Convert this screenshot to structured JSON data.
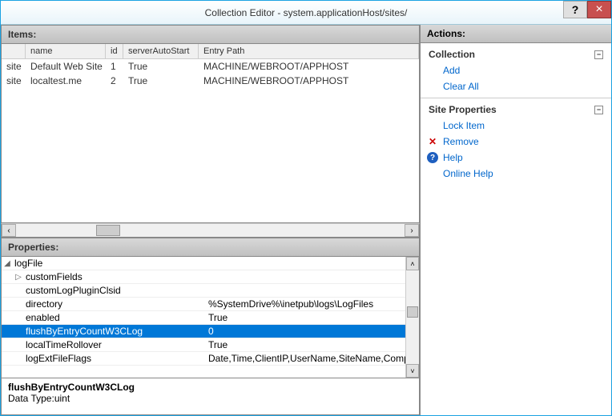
{
  "title": "Collection Editor - system.applicationHost/sites/",
  "itemsHeader": "Items:",
  "propsHeader": "Properties:",
  "actionsHeader": "Actions:",
  "columns": {
    "type": "",
    "name": "name",
    "id": "id",
    "serverAutoStart": "serverAutoStart",
    "entryPath": "Entry Path"
  },
  "items": [
    {
      "type": "site",
      "name": "Default Web Site",
      "id": "1",
      "serverAutoStart": "True",
      "entryPath": "MACHINE/WEBROOT/APPHOST"
    },
    {
      "type": "site",
      "name": "localtest.me",
      "id": "2",
      "serverAutoStart": "True",
      "entryPath": "MACHINE/WEBROOT/APPHOST"
    }
  ],
  "properties": {
    "root": "logFile",
    "rows": [
      {
        "indent": 1,
        "expand": "▷",
        "name": "customFields",
        "value": ""
      },
      {
        "indent": 1,
        "expand": "",
        "name": "customLogPluginClsid",
        "value": ""
      },
      {
        "indent": 1,
        "expand": "",
        "name": "directory",
        "value": "%SystemDrive%\\inetpub\\logs\\LogFiles"
      },
      {
        "indent": 1,
        "expand": "",
        "name": "enabled",
        "value": "True"
      },
      {
        "indent": 1,
        "expand": "",
        "name": "flushByEntryCountW3CLog",
        "value": "0",
        "selected": true
      },
      {
        "indent": 1,
        "expand": "",
        "name": "localTimeRollover",
        "value": "True"
      },
      {
        "indent": 1,
        "expand": "",
        "name": "logExtFileFlags",
        "value": "Date,Time,ClientIP,UserName,SiteName,Comp"
      }
    ]
  },
  "description": {
    "title": "flushByEntryCountW3CLog",
    "type": "Data Type:uint"
  },
  "actions": {
    "collection": {
      "header": "Collection",
      "items": [
        "Add",
        "Clear All"
      ]
    },
    "siteProps": {
      "header": "Site Properties",
      "items": [
        {
          "label": "Lock Item",
          "icon": ""
        },
        {
          "label": "Remove",
          "icon": "x"
        },
        {
          "label": "Help",
          "icon": "help"
        },
        {
          "label": "Online Help",
          "icon": ""
        }
      ]
    }
  }
}
